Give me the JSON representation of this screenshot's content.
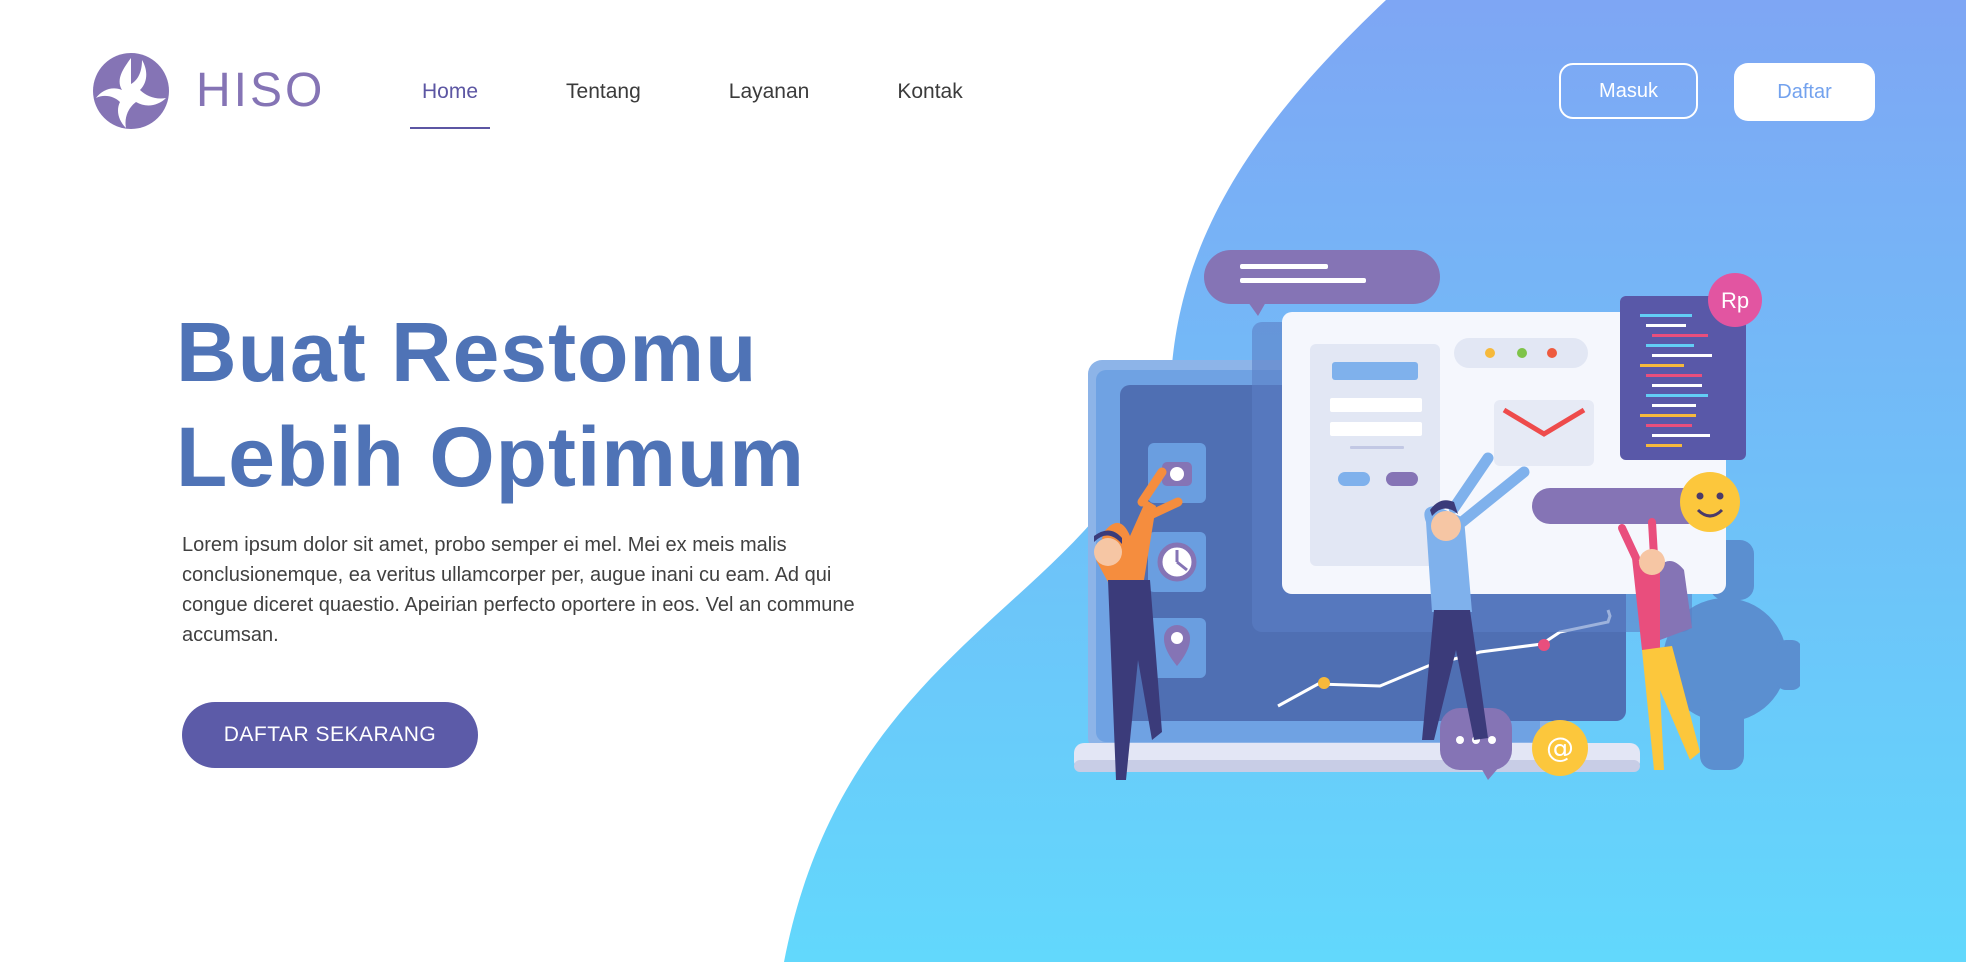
{
  "brand": {
    "name": "HISO",
    "logo_icon": "hiso-logo-icon",
    "color": "#8574b5"
  },
  "nav": {
    "items": [
      {
        "label": "Home",
        "active": true
      },
      {
        "label": "Tentang",
        "active": false
      },
      {
        "label": "Layanan",
        "active": false
      },
      {
        "label": "Kontak",
        "active": false
      }
    ],
    "active_color": "#5c56a3"
  },
  "auth": {
    "login_label": "Masuk",
    "register_label": "Daftar"
  },
  "hero": {
    "title_line1": "Buat Restomu",
    "title_line2": "Lebih Optimum",
    "description": "Lorem ipsum dolor sit amet, probo semper ei mel. Mei ex meis malis conclusionemque, ea veritus ullamcorper per, augue inani cu eam. Ad qui congue diceret quaestio. Apeirian perfecto oportere in eos. Vel an commune accumsan.",
    "cta_label": "DAFTAR SEKARANG"
  },
  "illustration": {
    "currency_badge": "Rp",
    "at_badge": "@",
    "icons": [
      "camera-icon",
      "clock-icon",
      "location-pin-icon",
      "envelope-icon",
      "smiley-icon",
      "gear-icon",
      "chat-bubble-icon"
    ]
  },
  "colors": {
    "title": "#4f73b6",
    "cta": "#5c5ba8",
    "gradient_top": "#7ea6f4",
    "gradient_bottom": "#62d8fc"
  }
}
